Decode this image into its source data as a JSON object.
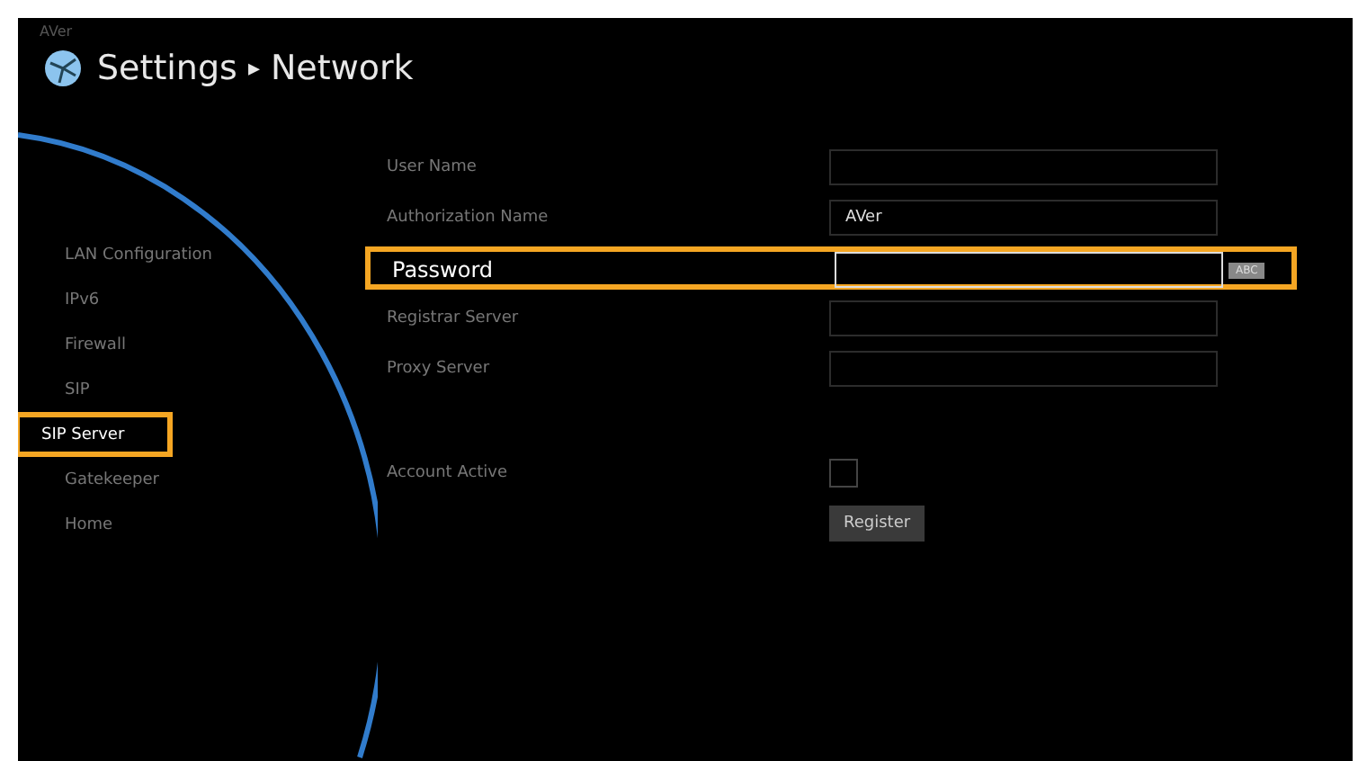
{
  "brand": "AVer",
  "header": {
    "title": "Settings",
    "separator": "▸",
    "section": "Network"
  },
  "sidebar": {
    "items": [
      {
        "label": "LAN Configuration",
        "selected": false
      },
      {
        "label": "IPv6",
        "selected": false
      },
      {
        "label": "Firewall",
        "selected": false
      },
      {
        "label": "SIP",
        "selected": false
      },
      {
        "label": "SIP Server",
        "selected": true
      },
      {
        "label": "Gatekeeper",
        "selected": false
      },
      {
        "label": "Home",
        "selected": false
      }
    ]
  },
  "form": {
    "fields": [
      {
        "label": "User Name",
        "focused": false
      },
      {
        "label": "Authorization Name",
        "value": "AVer",
        "focused": false
      },
      {
        "label": "Password",
        "focused": true,
        "input_mode": "ABC"
      },
      {
        "label": "Registrar Server",
        "focused": false
      },
      {
        "label": "Proxy Server",
        "focused": false
      }
    ],
    "account_active": {
      "label": "Account Active",
      "checked": false
    },
    "register_button": "Register"
  }
}
